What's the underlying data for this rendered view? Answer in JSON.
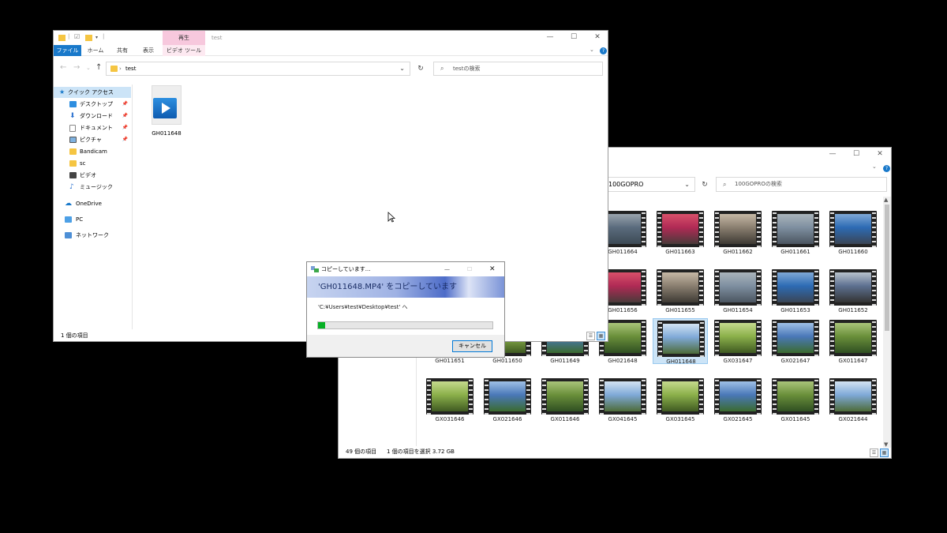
{
  "back_window": {
    "address_text": "100GOPRO",
    "search_placeholder": "100GOPROの検索",
    "status_count": "49 個の項目",
    "status_selection": "1 個の項目を選択  3.72 GB",
    "files_row1": [
      "GH011664",
      "GH011663",
      "GH011662",
      "GH011661",
      "GH011660"
    ],
    "files_row2": [
      "GH011656",
      "GH011655",
      "GH011654",
      "GH011653",
      "GH011652"
    ],
    "files_row3": [
      "GH011651",
      "GH011650",
      "GH011649",
      "GH021648",
      "GH011648",
      "GX031647",
      "GX021647",
      "GX011647"
    ],
    "files_row4": [
      "GX031646",
      "GX021646",
      "GX011646",
      "GX041645",
      "GX031645",
      "GX021645",
      "GX011645",
      "GX021644"
    ],
    "selected_file": "GH011648"
  },
  "front_window": {
    "title": "test",
    "context_tab": "再生",
    "ribbon_tabs": [
      "ファイル",
      "ホーム",
      "共有",
      "表示",
      "ビデオ ツール"
    ],
    "address_text": "test",
    "search_placeholder": "testの検索",
    "nav_items": [
      "クイック アクセス",
      "デスクトップ",
      "ダウンロード",
      "ドキュメント",
      "ピクチャ",
      "Bandicam",
      "sc",
      "ビデオ",
      "ミュージック",
      "OneDrive",
      "PC",
      "ネットワーク"
    ],
    "file_name": "GH011648",
    "status": "1 個の項目"
  },
  "copy_dialog": {
    "title": "コピーしています...",
    "heading": "'GH011648.MP4' をコピーしています",
    "destination": "'C:¥Users¥test¥Desktop¥test' へ",
    "progress": 0.04,
    "cancel_label": "キャンセル"
  },
  "colors": {
    "accent": "#1979ca",
    "context_tab": "#f7c8dd",
    "progress": "#06b025",
    "selection": "#cce4f7"
  }
}
